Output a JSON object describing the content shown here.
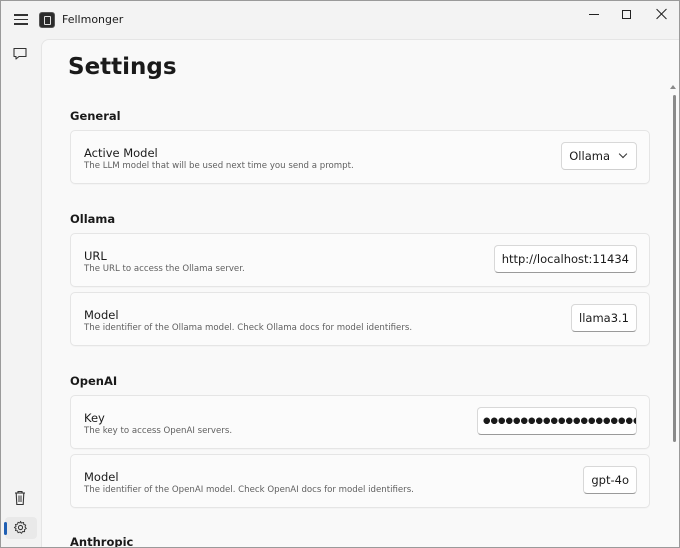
{
  "window": {
    "title": "Fellmonger"
  },
  "page": {
    "title": "Settings"
  },
  "sections": {
    "general": "General",
    "ollama": "Ollama",
    "openai": "OpenAI",
    "anthropic": "Anthropic"
  },
  "general": {
    "active_model": {
      "label": "Active Model",
      "description": "The LLM model that will be used next time you send a prompt.",
      "value": "Ollama"
    }
  },
  "ollama": {
    "url": {
      "label": "URL",
      "description": "The URL to access the Ollama server.",
      "value": "http://localhost:11434"
    },
    "model": {
      "label": "Model",
      "description": "The identifier of the Ollama model. Check Ollama docs for model identifiers.",
      "value": "llama3.1"
    }
  },
  "openai": {
    "key": {
      "label": "Key",
      "description": "The key to access OpenAI servers.",
      "value": "●●●●●●●●●●●●●●●●●●●●●●●●●●●●●●●"
    },
    "model": {
      "label": "Model",
      "description": "The identifier of the OpenAI model. Check OpenAI docs for model identifiers.",
      "value": "gpt-4o"
    }
  },
  "nav": {
    "chat_icon": "chat-icon",
    "trash_icon": "trash-icon",
    "settings_icon": "gear-icon"
  },
  "colors": {
    "accent": "#1f5fb3"
  }
}
